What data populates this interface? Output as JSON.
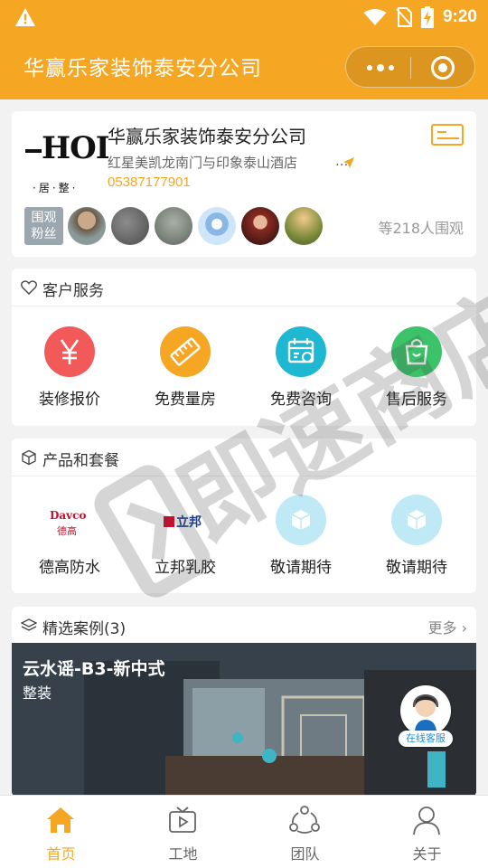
{
  "status_bar": {
    "time": "9:20"
  },
  "header": {
    "title": "华赢乐家装饰泰安分公司"
  },
  "company": {
    "logo_text": "HOI",
    "logo_sub": "·居·整·",
    "name": "华赢乐家装饰泰安分公司",
    "address": "红星美凯龙南门与印象泰山酒店",
    "address_ellipsis": "...",
    "phone": "05387177901",
    "fans_badge": "围观\n粉丝",
    "watchers": "等218人围观"
  },
  "service": {
    "title": "客户服务",
    "items": [
      {
        "label": "装修报价",
        "icon": "yen-icon",
        "color": "#f25a5a"
      },
      {
        "label": "免费量房",
        "icon": "ruler-icon",
        "color": "#f5a623"
      },
      {
        "label": "免费咨询",
        "icon": "calendar-icon",
        "color": "#1fb8d3"
      },
      {
        "label": "售后服务",
        "icon": "bag-icon",
        "color": "#3cc36a"
      }
    ]
  },
  "products": {
    "title": "产品和套餐",
    "items": [
      {
        "label": "德高防水",
        "logo": "Davco",
        "logo_cn": "德高"
      },
      {
        "label": "立邦乳胶",
        "logo": "立邦"
      },
      {
        "label": "敬请期待",
        "icon": "cube-icon"
      },
      {
        "label": "敬请期待",
        "icon": "cube-icon"
      }
    ]
  },
  "cases": {
    "title": "精选案例(3)",
    "more": "更多",
    "case_title": "云水谣-B3-新中式",
    "case_sub": "整装"
  },
  "kefu": {
    "label": "在线客服"
  },
  "watermark": {
    "text": "即速商店"
  },
  "tabbar": {
    "items": [
      {
        "label": "首页",
        "icon": "home-icon",
        "active": true
      },
      {
        "label": "工地",
        "icon": "tv-icon",
        "active": false
      },
      {
        "label": "团队",
        "icon": "team-icon",
        "active": false
      },
      {
        "label": "关于",
        "icon": "person-icon",
        "active": false
      }
    ]
  },
  "colors": {
    "accent": "#f5a623",
    "background": "#f2f2f2"
  }
}
